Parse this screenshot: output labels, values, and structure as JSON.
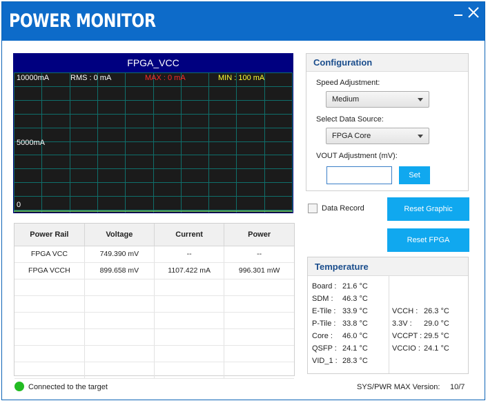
{
  "window": {
    "title": "POWER MONITOR",
    "close_glyph": "✕"
  },
  "graph": {
    "title": "FPGA_VCC",
    "y_top_label": "10000mA",
    "y_mid_label": "5000mA",
    "y_zero_label": "0",
    "rms": "RMS : 0 mA",
    "max": "MAX : 0 mA",
    "min": "MIN : 100 mA",
    "colors": {
      "background": "#1b1b1b",
      "grid": "#0f6f6b",
      "header": "#000080",
      "trace": "#6fd06f"
    }
  },
  "table": {
    "headers": [
      "Power Rail",
      "Voltage",
      "Current",
      "Power"
    ],
    "rows": [
      [
        "FPGA VCC",
        "749.390 mV",
        "--",
        "--"
      ],
      [
        "FPGA VCCH",
        "899.658 mV",
        "1107.422 mA",
        "996.301 mW"
      ]
    ]
  },
  "config": {
    "title": "Configuration",
    "speed_label": "Speed Adjustment:",
    "speed_value": "Medium",
    "source_label": "Select Data Source:",
    "source_value": "FPGA Core",
    "vout_label": "VOUT Adjustment (mV):",
    "vout_value": "",
    "set_label": "Set"
  },
  "controls": {
    "data_record_label": "Data Record",
    "reset_graphic_label": "Reset Graphic",
    "reset_fpga_label": "Reset FPGA"
  },
  "temperature": {
    "title": "Temperature",
    "left": [
      {
        "label": "Board :",
        "value": "21.6 °C"
      },
      {
        "label": "SDM :",
        "value": "46.3 °C"
      },
      {
        "label": "E-Tile :",
        "value": "33.9 °C"
      },
      {
        "label": "P-Tile :",
        "value": "33.8 °C"
      },
      {
        "label": "Core :",
        "value": "46.0 °C"
      },
      {
        "label": "QSFP :",
        "value": "24.1 °C"
      },
      {
        "label": "VID_1 :",
        "value": "28.3 °C"
      }
    ],
    "right": [
      {
        "label": "VCCH :",
        "value": "26.3 °C"
      },
      {
        "label": "3.3V :",
        "value": "29.0 °C"
      },
      {
        "label": "VCCPT :",
        "value": "29.5 °C"
      },
      {
        "label": "VCCIO :",
        "value": "24.1 °C"
      }
    ]
  },
  "status": {
    "connection": "Connected to the target",
    "version_label": "SYS/PWR MAX Version:",
    "version_value": "10/7",
    "connected_color": "#22bb22"
  }
}
